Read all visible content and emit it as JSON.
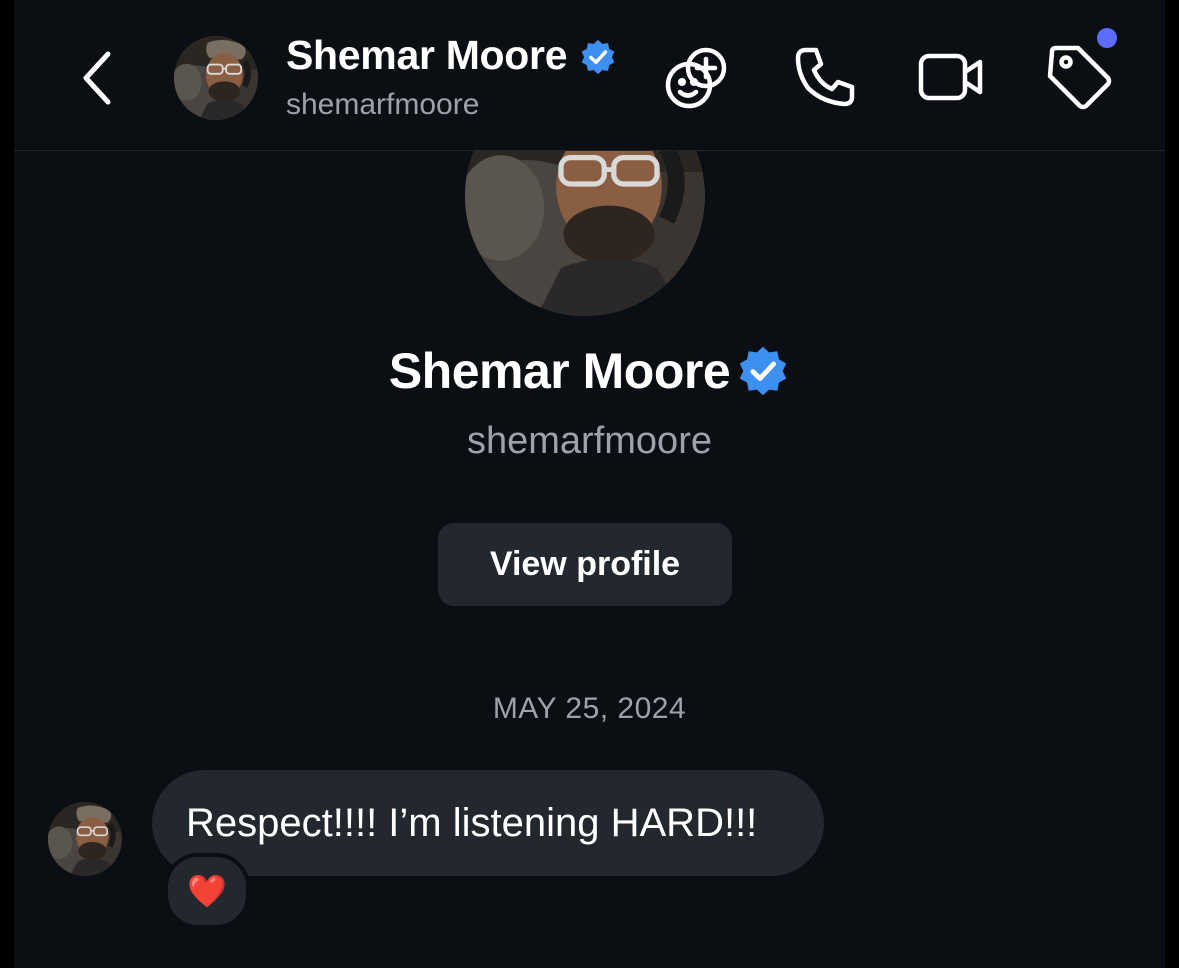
{
  "header": {
    "name": "Shemar Moore",
    "handle": "shemarfmoore",
    "back_icon": "chevron-left-icon",
    "actions": [
      "games-icon",
      "phone-icon",
      "video-icon",
      "tag-icon"
    ],
    "notification_dot_color": "#5b6cff"
  },
  "profile": {
    "name": "Shemar Moore",
    "handle": "shemarfmoore",
    "view_profile_label": "View profile",
    "verified_color": "#3d8ff0"
  },
  "thread": {
    "date_label": "MAY 25, 2024",
    "messages": [
      {
        "text": "Respect!!!! I’m listening HARD!!!",
        "reaction": "❤️"
      }
    ]
  }
}
